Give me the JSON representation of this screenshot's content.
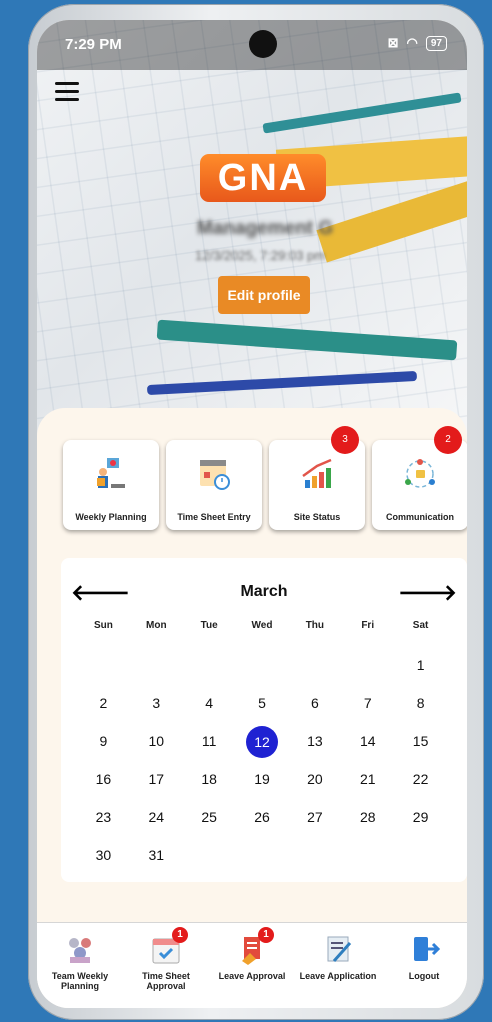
{
  "status_bar": {
    "time": "7:29 PM",
    "battery": "97"
  },
  "hero": {
    "logo_text": "GNA",
    "user_name": "Management G",
    "user_datetime": "12/3/2025, 7:29:03 pm",
    "edit_label": "Edit profile"
  },
  "cards": [
    {
      "label": "Weekly Planning",
      "icon": "weekly-planning-icon",
      "badge": ""
    },
    {
      "label": "Time Sheet Entry",
      "icon": "time-sheet-icon",
      "badge": ""
    },
    {
      "label": "Site Status",
      "icon": "site-status-icon",
      "badge": "3"
    },
    {
      "label": "Communication",
      "icon": "communication-icon",
      "badge": "2"
    }
  ],
  "calendar": {
    "month": "March",
    "weekdays": [
      "Sun",
      "Mon",
      "Tue",
      "Wed",
      "Thu",
      "Fri",
      "Sat"
    ],
    "weeks": [
      [
        "",
        "",
        "",
        "",
        "",
        "",
        "1"
      ],
      [
        "2",
        "3",
        "4",
        "5",
        "6",
        "7",
        "8"
      ],
      [
        "9",
        "10",
        "11",
        "12",
        "13",
        "14",
        "15"
      ],
      [
        "16",
        "17",
        "18",
        "19",
        "20",
        "21",
        "22"
      ],
      [
        "23",
        "24",
        "25",
        "26",
        "27",
        "28",
        "29"
      ],
      [
        "30",
        "31",
        "",
        "",
        "",
        "",
        ""
      ]
    ],
    "selected_day": "12",
    "selected_color": "#1f22d2"
  },
  "bottom_nav": [
    {
      "label": "Team Weekly Planning",
      "icon": "team-planning-icon",
      "badge": ""
    },
    {
      "label": "Time Sheet Approval",
      "icon": "timesheet-approval-icon",
      "badge": "1"
    },
    {
      "label": "Leave Approval",
      "icon": "leave-approval-icon",
      "badge": "1"
    },
    {
      "label": "Leave Application",
      "icon": "leave-application-icon",
      "badge": ""
    },
    {
      "label": "Logout",
      "icon": "logout-icon",
      "badge": ""
    }
  ],
  "colors": {
    "accent": "#e98a25",
    "badge": "#e31b1b",
    "background": "#2f78b7"
  }
}
